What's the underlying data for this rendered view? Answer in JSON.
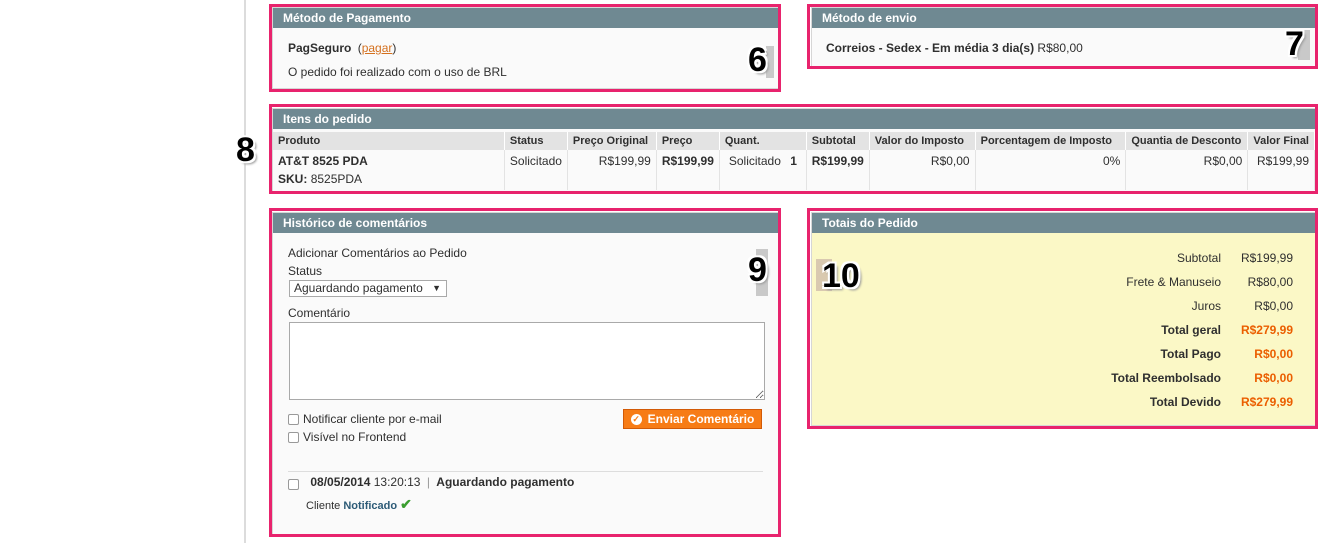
{
  "payment": {
    "header": "Método de Pagamento",
    "method": "PagSeguro",
    "link_open": "(",
    "link": "pagar",
    "link_close": ")",
    "note": "O pedido foi realizado com o uso de BRL",
    "marker": "6"
  },
  "shipping": {
    "header": "Método de envio",
    "method": "Correios - Sedex - Em média 3 dia(s)",
    "price": "R$80,00",
    "marker": "7"
  },
  "items": {
    "header": "Itens do pedido",
    "marker": "8",
    "columns": [
      "Produto",
      "Status",
      "Preço Original",
      "Preço",
      "Quant.",
      "Subtotal",
      "Valor do Imposto",
      "Porcentagem de Imposto",
      "Quantia de Desconto",
      "Valor Final"
    ],
    "rows": [
      {
        "product": "AT&T 8525 PDA",
        "sku_label": "SKU:",
        "sku": "8525PDA",
        "status": "Solicitado",
        "original_price": "R$199,99",
        "price": "R$199,99",
        "qty_label": "Solicitado",
        "qty": "1",
        "subtotal": "R$199,99",
        "tax_amount": "R$0,00",
        "tax_percent": "0%",
        "discount": "R$0,00",
        "row_total": "R$199,99"
      }
    ]
  },
  "history": {
    "header": "Histórico de comentários",
    "marker": "9",
    "add_label": "Adicionar Comentários ao Pedido",
    "status_label": "Status",
    "status_value": "Aguardando pagamento",
    "comment_label": "Comentário",
    "comment_value": "",
    "notify_label": "Notificar cliente por e-mail",
    "visible_label": "Visível no Frontend",
    "submit_label": "Enviar Comentário",
    "entry": {
      "date": "08/05/2014",
      "time": "13:20:13",
      "separator": "|",
      "status": "Aguardando pagamento",
      "customer_label": "Cliente",
      "notified": "Notificado"
    }
  },
  "totals": {
    "header": "Totais do Pedido",
    "marker": "10",
    "rows": [
      {
        "label": "Subtotal",
        "value": "R$199,99"
      },
      {
        "label": "Frete & Manuseio",
        "value": "R$80,00"
      },
      {
        "label": "Juros",
        "value": "R$0,00"
      },
      {
        "label": "Total geral",
        "value": "R$279,99"
      },
      {
        "label": "Total Pago",
        "value": "R$0,00"
      },
      {
        "label": "Total Reembolsado",
        "value": "R$0,00"
      },
      {
        "label": "Total Devido",
        "value": "R$279,99"
      }
    ]
  },
  "colors": {
    "header_bg": "#6f8992",
    "highlight_frame": "#e8236d",
    "accent_orange": "#eb5e00",
    "button_orange": "#f77c16",
    "totals_bg": "#fbf8c6",
    "notified_blue": "#2d5b77",
    "check_green": "#3a9e2f"
  }
}
